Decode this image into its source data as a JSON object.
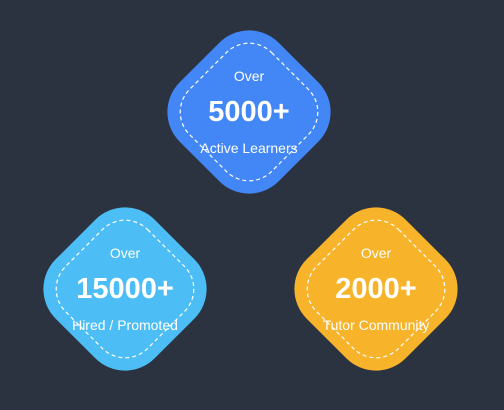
{
  "stats": [
    {
      "prefix": "Over",
      "value": "5000+",
      "caption": "Active Learners",
      "color": "#4287f5"
    },
    {
      "prefix": "Over",
      "value": "15000+",
      "caption": "Hired / Promoted",
      "color": "#4dbef5"
    },
    {
      "prefix": "Over",
      "value": "2000+",
      "caption": "Tutor Community",
      "color": "#f7b32a"
    }
  ]
}
